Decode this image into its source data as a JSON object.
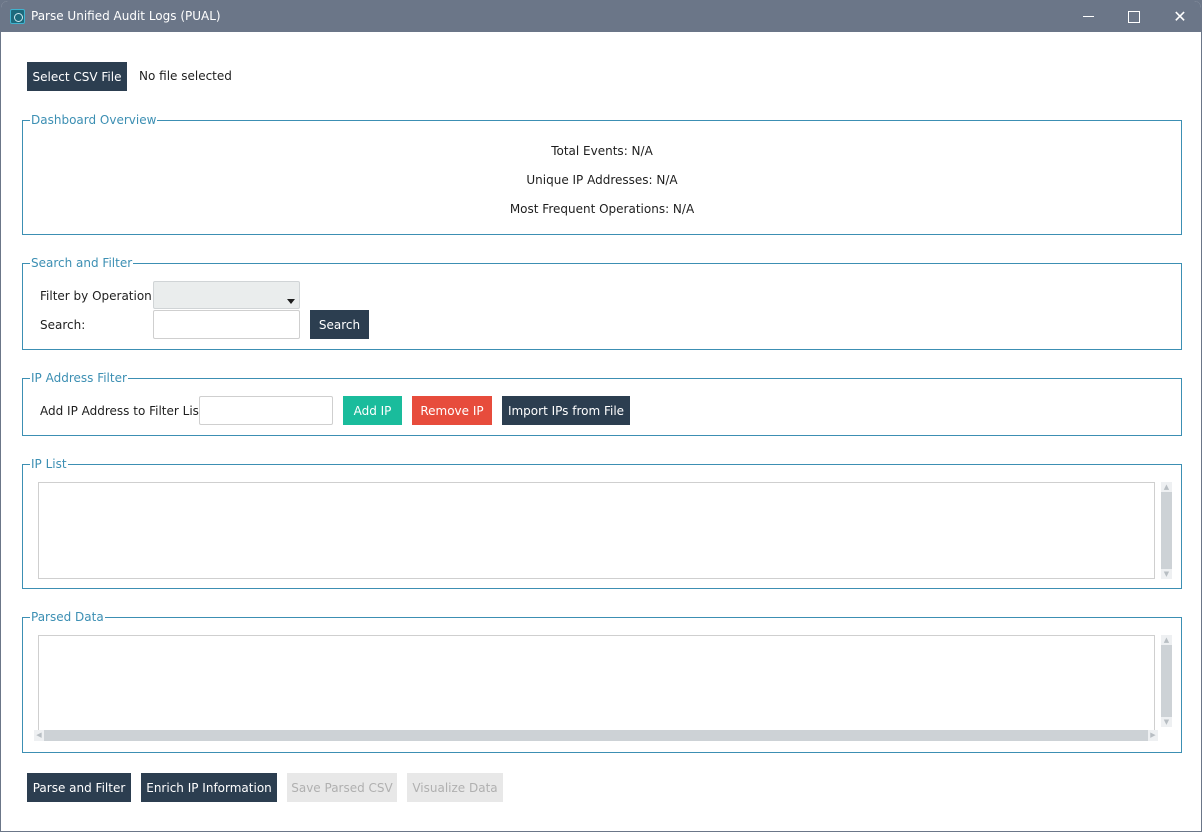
{
  "window": {
    "title": "Parse Unified Audit Logs (PUAL)",
    "icon": "app-icon",
    "controls": {
      "minimize": "minimize-icon",
      "maximize": "maximize-icon",
      "close_glyph": "✕"
    }
  },
  "file": {
    "select_button": "Select CSV File",
    "status": "No file selected"
  },
  "dashboard": {
    "title": "Dashboard Overview",
    "total_events": "Total Events: N/A",
    "unique_ips": "Unique IP Addresses: N/A",
    "frequent_ops": "Most Frequent Operations: N/A"
  },
  "search_filter": {
    "title": "Search and Filter",
    "operation_label": "Filter by Operation:",
    "operation_selected": "",
    "search_label": "Search:",
    "search_value": "",
    "search_button": "Search"
  },
  "ip_filter": {
    "title": "IP Address Filter",
    "add_label": "Add IP Address to Filter List:",
    "ip_value": "",
    "add_button": "Add IP",
    "remove_button": "Remove IP",
    "import_button": "Import IPs from File"
  },
  "ip_list": {
    "title": "IP List",
    "items": []
  },
  "parsed_data": {
    "title": "Parsed Data",
    "content": ""
  },
  "actions": {
    "parse_filter": "Parse and Filter",
    "enrich_ip": "Enrich IP Information",
    "save_csv": "Save Parsed CSV",
    "visualize": "Visualize Data"
  },
  "colors": {
    "dark_button": "#2c3e50",
    "add_button": "#1abc9c",
    "remove_button": "#e74c3c",
    "group_border": "#3c8fb3",
    "titlebar": "#6b7688"
  }
}
